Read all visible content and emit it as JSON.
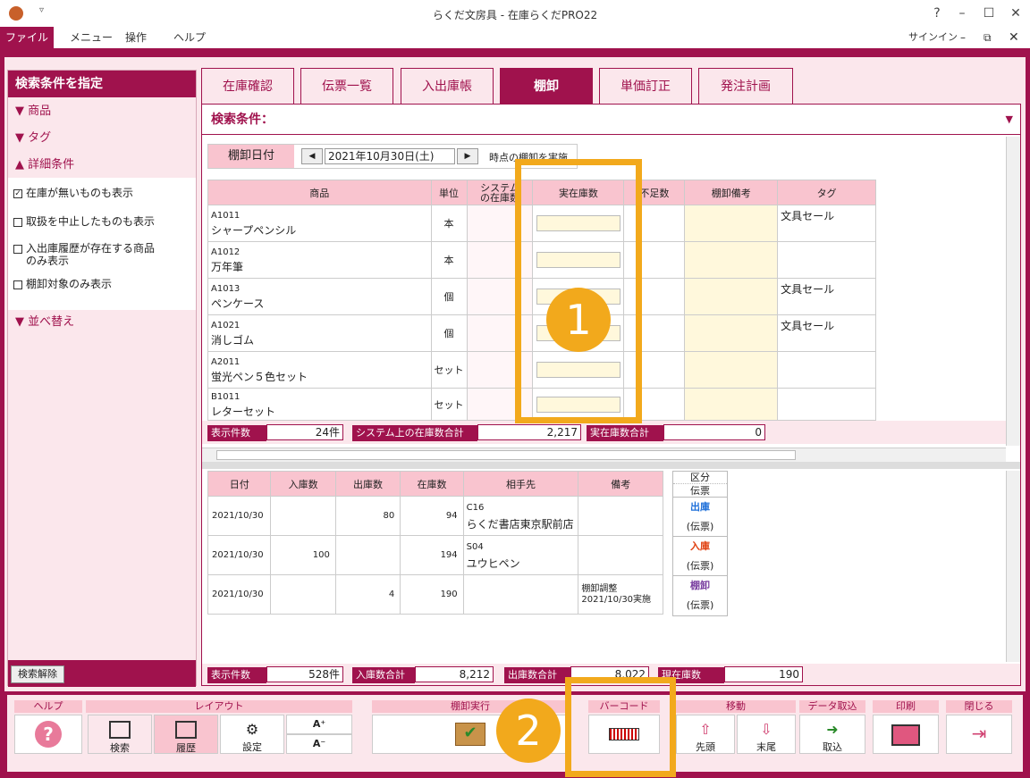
{
  "window": {
    "title": "らくだ文房具 - 在庫らくだPRO22",
    "help": "?",
    "signin": "サインイン"
  },
  "menu": {
    "file": "ファイル",
    "items": [
      "メニュー",
      "操作",
      "ヘルプ"
    ]
  },
  "left": {
    "header": "検索条件を指定",
    "sections": [
      "商品",
      "タグ",
      "詳細条件",
      "並べ替え"
    ],
    "checks": [
      {
        "label": "在庫が無いものも表示",
        "checked": true
      },
      {
        "label": "取扱を中止したものも表示",
        "checked": false
      },
      {
        "label": "入出庫履歴が存在する商品",
        "label2": "のみ表示",
        "checked": false
      },
      {
        "label": "棚卸対象のみ表示",
        "checked": false
      }
    ],
    "clear": "検索解除"
  },
  "tabs": [
    "在庫確認",
    "伝票一覧",
    "入出庫帳",
    "棚卸",
    "単価訂正",
    "発注計画"
  ],
  "search_title": "検索条件：",
  "stock": {
    "date_label": "棚卸日付",
    "date": "2021年10月30日(土)",
    "note": "時点の棚卸を実施",
    "headers": [
      "商品",
      "単位",
      "システム\nの在庫数",
      "実在庫数",
      "不足数",
      "棚卸備考",
      "タグ"
    ],
    "rows": [
      {
        "code": "A1011",
        "name": "シャープペンシル",
        "unit": "本",
        "tag": "文具セール"
      },
      {
        "code": "A1012",
        "name": "万年筆",
        "unit": "本",
        "tag": ""
      },
      {
        "code": "A1013",
        "name": "ペンケース",
        "unit": "個",
        "tag": "文具セール"
      },
      {
        "code": "A1021",
        "name": "消しゴム",
        "unit": "個",
        "tag": "文具セール"
      },
      {
        "code": "A2011",
        "name": "蛍光ペン５色セット",
        "unit": "セット",
        "tag": ""
      },
      {
        "code": "B1011",
        "name": "レターセット",
        "unit": "セット",
        "tag": ""
      }
    ],
    "sum": [
      {
        "label": "表示件数",
        "value": "24件"
      },
      {
        "label": "システム上の在庫数合計",
        "value": "2,217"
      },
      {
        "label": "実在庫数合計",
        "value": "0"
      }
    ]
  },
  "history": {
    "headers": [
      "日付",
      "入庫数",
      "出庫数",
      "在庫数",
      "相手先",
      "備考"
    ],
    "rows": [
      {
        "date": "2021/10/30",
        "in": "",
        "out": "80",
        "stock": "94",
        "code": "C16",
        "partner": "らくだ書店東京駅前店",
        "note": "",
        "kind": "出庫",
        "kcolor": "#1e6fd9",
        "slip": "(伝票)"
      },
      {
        "date": "2021/10/30",
        "in": "100",
        "out": "",
        "stock": "194",
        "code": "S04",
        "partner": "ユウヒペン",
        "note": "",
        "kind": "入庫",
        "kcolor": "#e04010",
        "slip": "(伝票)"
      },
      {
        "date": "2021/10/30",
        "in": "",
        "out": "4",
        "stock": "190",
        "code": "",
        "partner": "",
        "note": "棚卸調整\n2021/10/30実施",
        "kind": "棚卸",
        "kcolor": "#7a3fa0",
        "slip": "(伝票)"
      }
    ],
    "legend": [
      "区分",
      "伝票"
    ],
    "sum": [
      {
        "label": "表示件数",
        "value": "528件"
      },
      {
        "label": "入庫数合計",
        "value": "8,212"
      },
      {
        "label": "出庫数合計",
        "value": "8,022"
      },
      {
        "label": "現在庫数",
        "value": "190"
      }
    ]
  },
  "toolbar": {
    "groups": [
      "ヘルプ",
      "レイアウト",
      "棚卸実行",
      "バーコード",
      "移動",
      "データ取込",
      "印刷",
      "閉じる"
    ],
    "buttons": [
      "検索",
      "履歴",
      "設定",
      "先頭",
      "末尾",
      "取込"
    ]
  },
  "callouts": [
    "1",
    "2"
  ]
}
